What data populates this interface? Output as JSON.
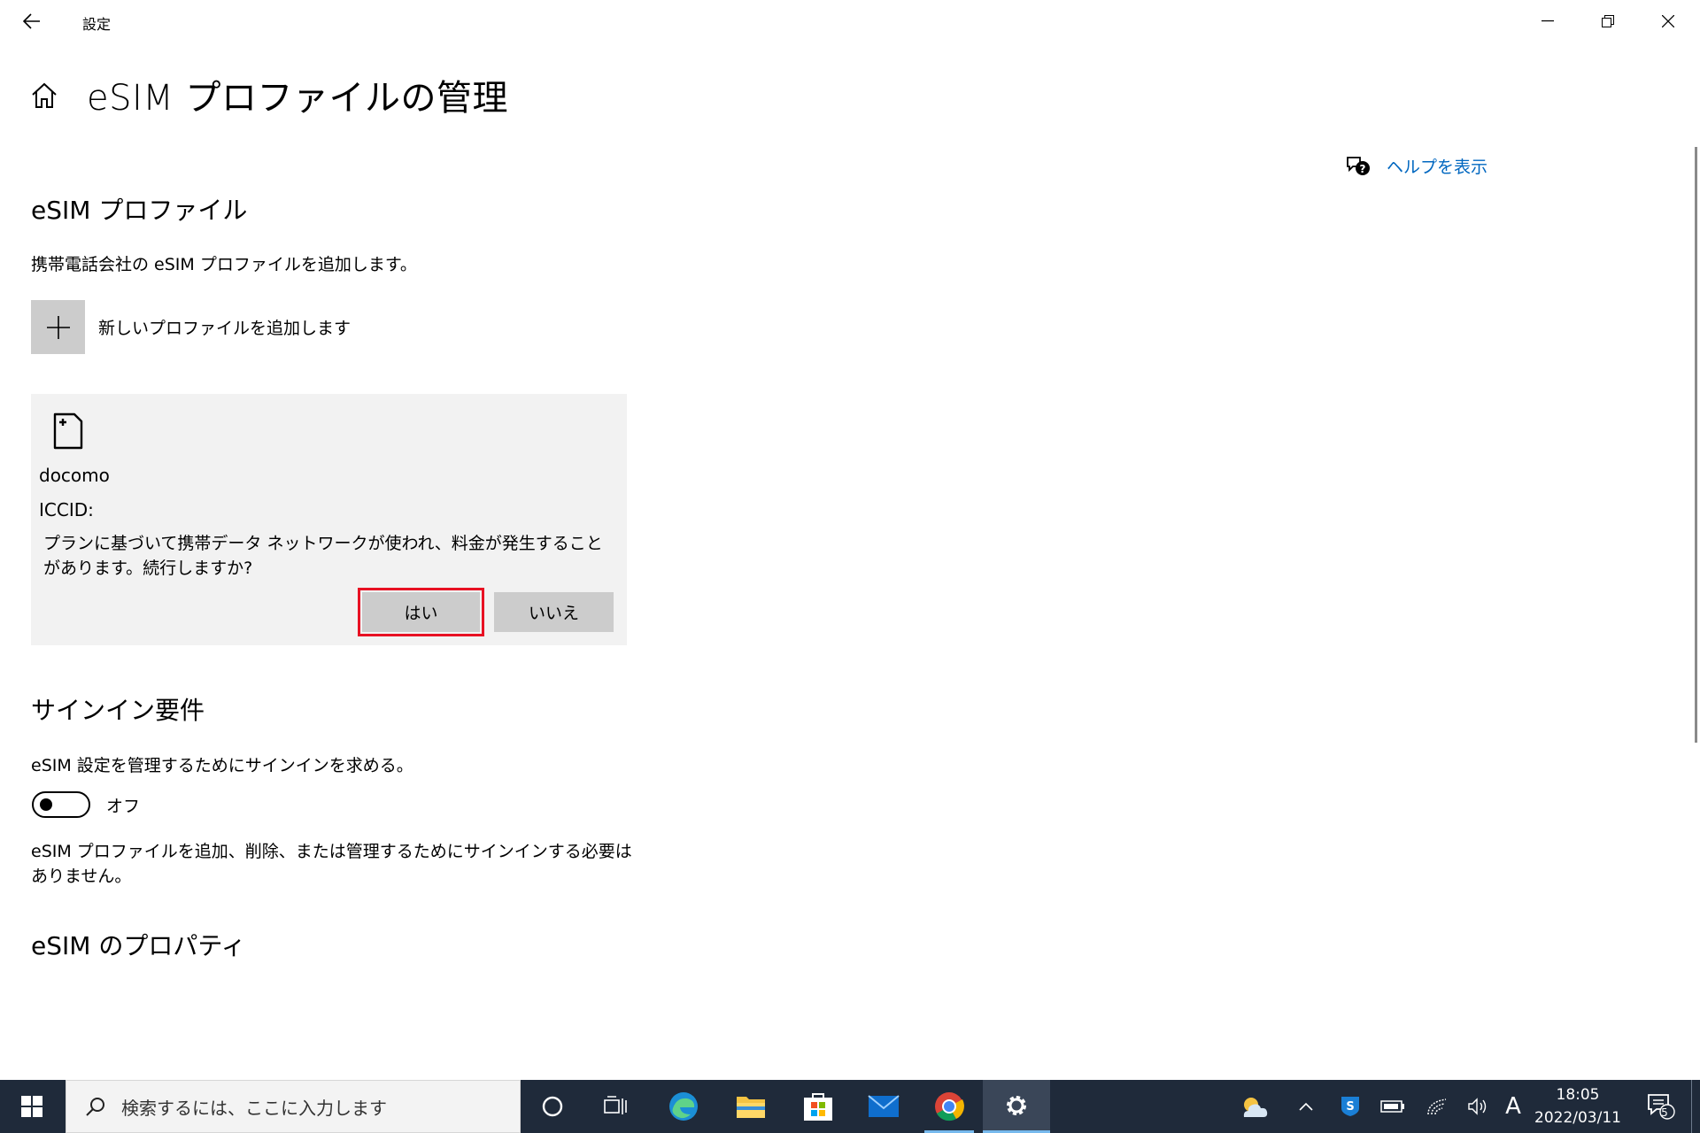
{
  "window": {
    "app_title": "設定"
  },
  "header": {
    "title": "eSIM プロファイルの管理",
    "help_label": "ヘルプを表示"
  },
  "profiles_section": {
    "title": "eSIM プロファイル",
    "description": "携帯電話会社の eSIM プロファイルを追加します。",
    "add_label": "新しいプロファイルを追加します"
  },
  "profile_card": {
    "name": "docomo",
    "iccid_label": "ICCID:",
    "message": "プランに基づいて携帯データ ネットワークが使われ、料金が発生することがあります。続行しますか?",
    "yes_label": "はい",
    "no_label": "いいえ"
  },
  "signin_section": {
    "title": "サインイン要件",
    "description": "eSIM 設定を管理するためにサインインを求める。",
    "toggle_state": "オフ",
    "toggle_on": false,
    "note": "eSIM プロファイルを追加、削除、または管理するためにサインインする必要はありません。"
  },
  "properties_section": {
    "title": "eSIM のプロパティ"
  },
  "taskbar": {
    "search_placeholder": "検索するには、ここに入力します",
    "ime_label": "A",
    "time": "18:05",
    "date": "2022/03/11",
    "notification_count": "5",
    "apps": [
      "cortana-icon",
      "task-view-icon",
      "edge-icon",
      "file-explorer-icon",
      "store-icon",
      "mail-icon",
      "chrome-icon",
      "settings-icon"
    ]
  },
  "colors": {
    "accent": "#0067c0",
    "highlight_border": "#e81123",
    "card_bg": "#f2f2f2",
    "button_bg": "#cccccc",
    "taskbar_bg": "#1f2a3a"
  }
}
